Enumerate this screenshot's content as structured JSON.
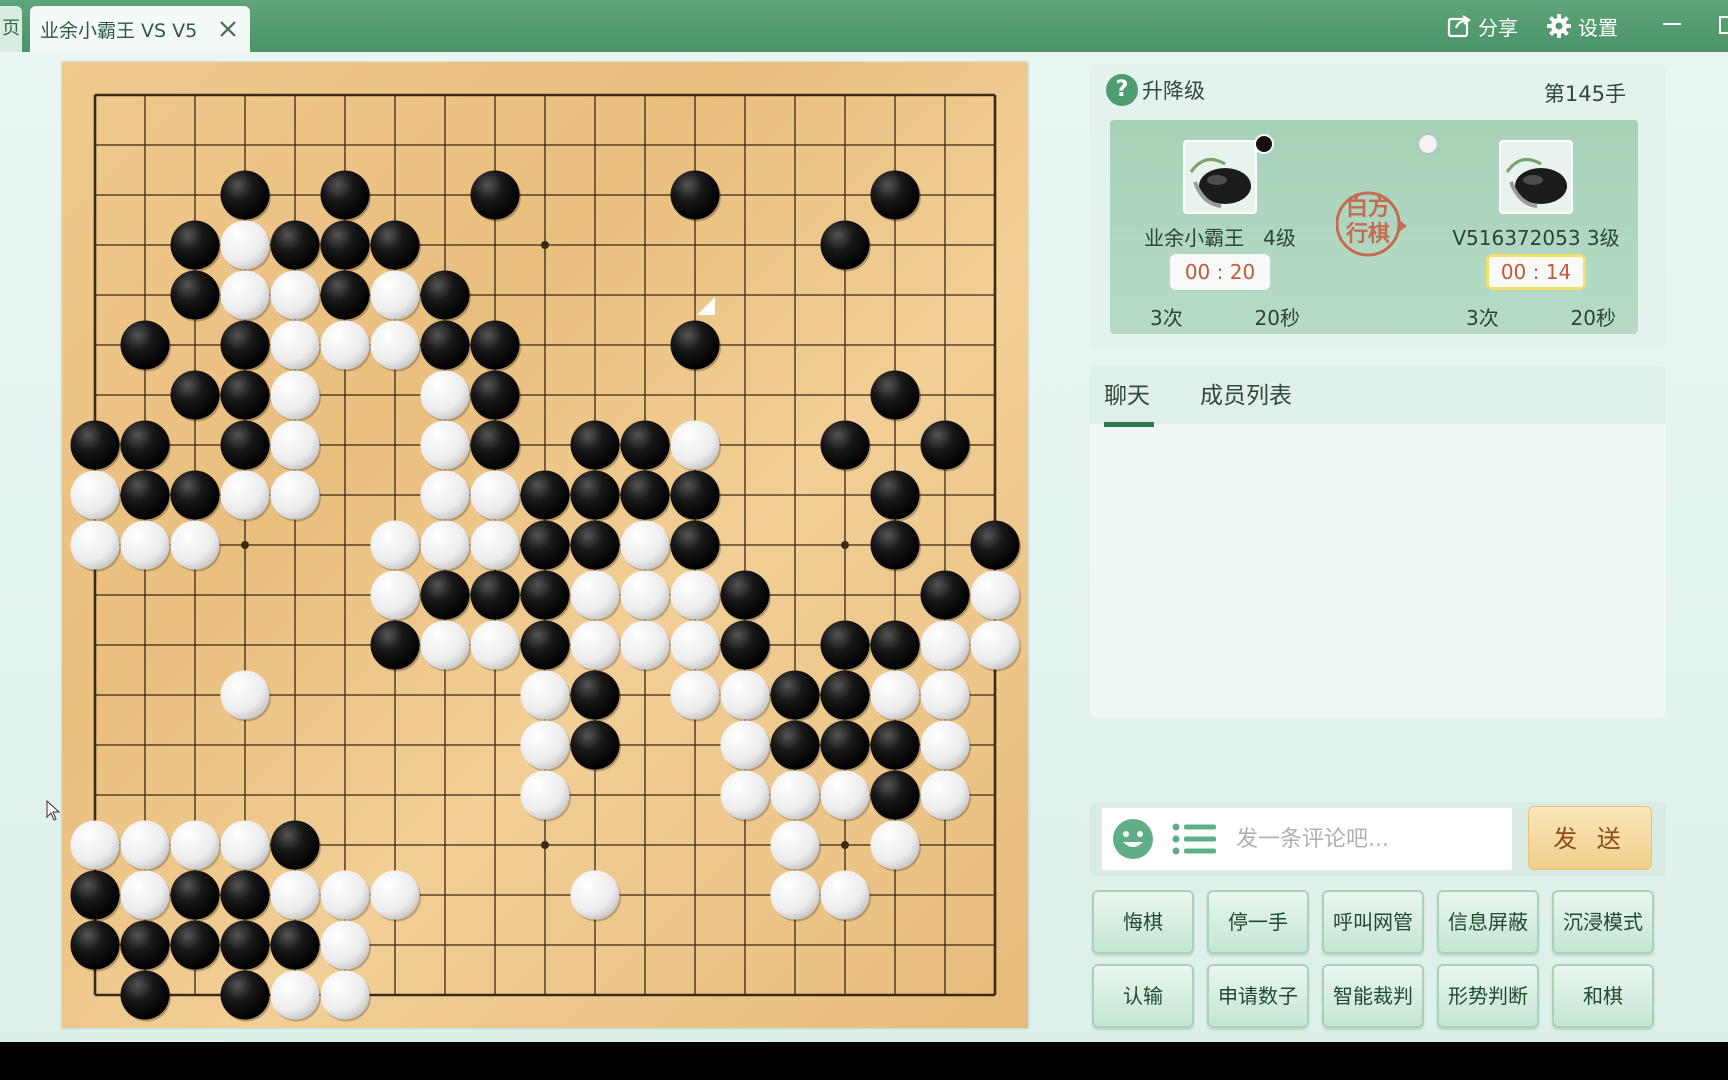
{
  "titlebar": {
    "stub_tab_label": "页",
    "tab_title": "业余小霸王 VS V5",
    "share_label": "分享",
    "settings_label": "设置"
  },
  "info": {
    "level_label": "升降级",
    "move_counter": "第145手",
    "turn_text": "白方行棋",
    "black_player": {
      "name": "业余小霸王",
      "rank": "4级",
      "timer": "00 : 20",
      "byo_count": "3次",
      "byo_time": "20秒"
    },
    "white_player": {
      "name": "V516372053",
      "rank": "3级",
      "timer": "00 : 14",
      "byo_count": "3次",
      "byo_time": "20秒"
    }
  },
  "chat": {
    "tab_chat": "聊天",
    "tab_members": "成员列表",
    "placeholder": "发一条评论吧...",
    "send_label": "发 送"
  },
  "actions": {
    "row1": [
      "悔棋",
      "停一手",
      "呼叫网管",
      "信息屏蔽",
      "沉浸模式"
    ],
    "row2": [
      "认输",
      "申请数子",
      "智能裁判",
      "形势判断",
      "和棋"
    ]
  },
  "board": {
    "size": 19,
    "last_move": [
      12,
      5
    ],
    "black_stones": [
      [
        3,
        3
      ],
      [
        5,
        3
      ],
      [
        8,
        3
      ],
      [
        12,
        3
      ],
      [
        16,
        3
      ],
      [
        2,
        4
      ],
      [
        4,
        4
      ],
      [
        5,
        4
      ],
      [
        6,
        4
      ],
      [
        15,
        4
      ],
      [
        2,
        5
      ],
      [
        5,
        5
      ],
      [
        7,
        5
      ],
      [
        1,
        6
      ],
      [
        3,
        6
      ],
      [
        7,
        6
      ],
      [
        8,
        6
      ],
      [
        12,
        6
      ],
      [
        2,
        7
      ],
      [
        3,
        7
      ],
      [
        8,
        7
      ],
      [
        16,
        7
      ],
      [
        0,
        8
      ],
      [
        1,
        8
      ],
      [
        3,
        8
      ],
      [
        8,
        8
      ],
      [
        10,
        8
      ],
      [
        11,
        8
      ],
      [
        15,
        8
      ],
      [
        17,
        8
      ],
      [
        1,
        9
      ],
      [
        2,
        9
      ],
      [
        9,
        9
      ],
      [
        10,
        9
      ],
      [
        11,
        9
      ],
      [
        12,
        9
      ],
      [
        16,
        9
      ],
      [
        9,
        10
      ],
      [
        10,
        10
      ],
      [
        12,
        10
      ],
      [
        16,
        10
      ],
      [
        18,
        10
      ],
      [
        7,
        11
      ],
      [
        8,
        11
      ],
      [
        9,
        11
      ],
      [
        13,
        11
      ],
      [
        17,
        11
      ],
      [
        6,
        12
      ],
      [
        9,
        12
      ],
      [
        13,
        12
      ],
      [
        15,
        12
      ],
      [
        16,
        12
      ],
      [
        10,
        13
      ],
      [
        14,
        13
      ],
      [
        15,
        13
      ],
      [
        10,
        14
      ],
      [
        14,
        14
      ],
      [
        15,
        14
      ],
      [
        16,
        14
      ],
      [
        16,
        15
      ],
      [
        4,
        16
      ],
      [
        0,
        17
      ],
      [
        2,
        17
      ],
      [
        3,
        17
      ],
      [
        0,
        18
      ],
      [
        1,
        18
      ],
      [
        2,
        18
      ],
      [
        3,
        18
      ],
      [
        4,
        18
      ],
      [
        1,
        19
      ],
      [
        3,
        19
      ]
    ],
    "white_stones": [
      [
        3,
        4
      ],
      [
        3,
        5
      ],
      [
        4,
        5
      ],
      [
        6,
        5
      ],
      [
        4,
        6
      ],
      [
        5,
        6
      ],
      [
        6,
        6
      ],
      [
        4,
        7
      ],
      [
        7,
        7
      ],
      [
        4,
        8
      ],
      [
        7,
        8
      ],
      [
        12,
        8
      ],
      [
        0,
        9
      ],
      [
        3,
        9
      ],
      [
        4,
        9
      ],
      [
        7,
        9
      ],
      [
        8,
        9
      ],
      [
        0,
        10
      ],
      [
        1,
        10
      ],
      [
        2,
        10
      ],
      [
        6,
        10
      ],
      [
        7,
        10
      ],
      [
        8,
        10
      ],
      [
        11,
        10
      ],
      [
        6,
        11
      ],
      [
        10,
        11
      ],
      [
        11,
        11
      ],
      [
        12,
        11
      ],
      [
        18,
        11
      ],
      [
        7,
        12
      ],
      [
        8,
        12
      ],
      [
        10,
        12
      ],
      [
        11,
        12
      ],
      [
        12,
        12
      ],
      [
        17,
        12
      ],
      [
        18,
        12
      ],
      [
        3,
        13
      ],
      [
        9,
        13
      ],
      [
        12,
        13
      ],
      [
        13,
        13
      ],
      [
        16,
        13
      ],
      [
        17,
        13
      ],
      [
        9,
        14
      ],
      [
        13,
        14
      ],
      [
        17,
        14
      ],
      [
        9,
        15
      ],
      [
        13,
        15
      ],
      [
        14,
        15
      ],
      [
        15,
        15
      ],
      [
        17,
        15
      ],
      [
        0,
        16
      ],
      [
        1,
        16
      ],
      [
        2,
        16
      ],
      [
        3,
        16
      ],
      [
        14,
        16
      ],
      [
        16,
        16
      ],
      [
        1,
        17
      ],
      [
        4,
        17
      ],
      [
        5,
        17
      ],
      [
        6,
        17
      ],
      [
        10,
        17
      ],
      [
        14,
        17
      ],
      [
        15,
        17
      ],
      [
        5,
        18
      ],
      [
        4,
        19
      ],
      [
        5,
        19
      ]
    ]
  },
  "colors": {
    "titlebar": "#4f9a6c",
    "accent": "#2c7a4f",
    "timer_text": "#c25a3a",
    "seal": "#c56b4f"
  }
}
